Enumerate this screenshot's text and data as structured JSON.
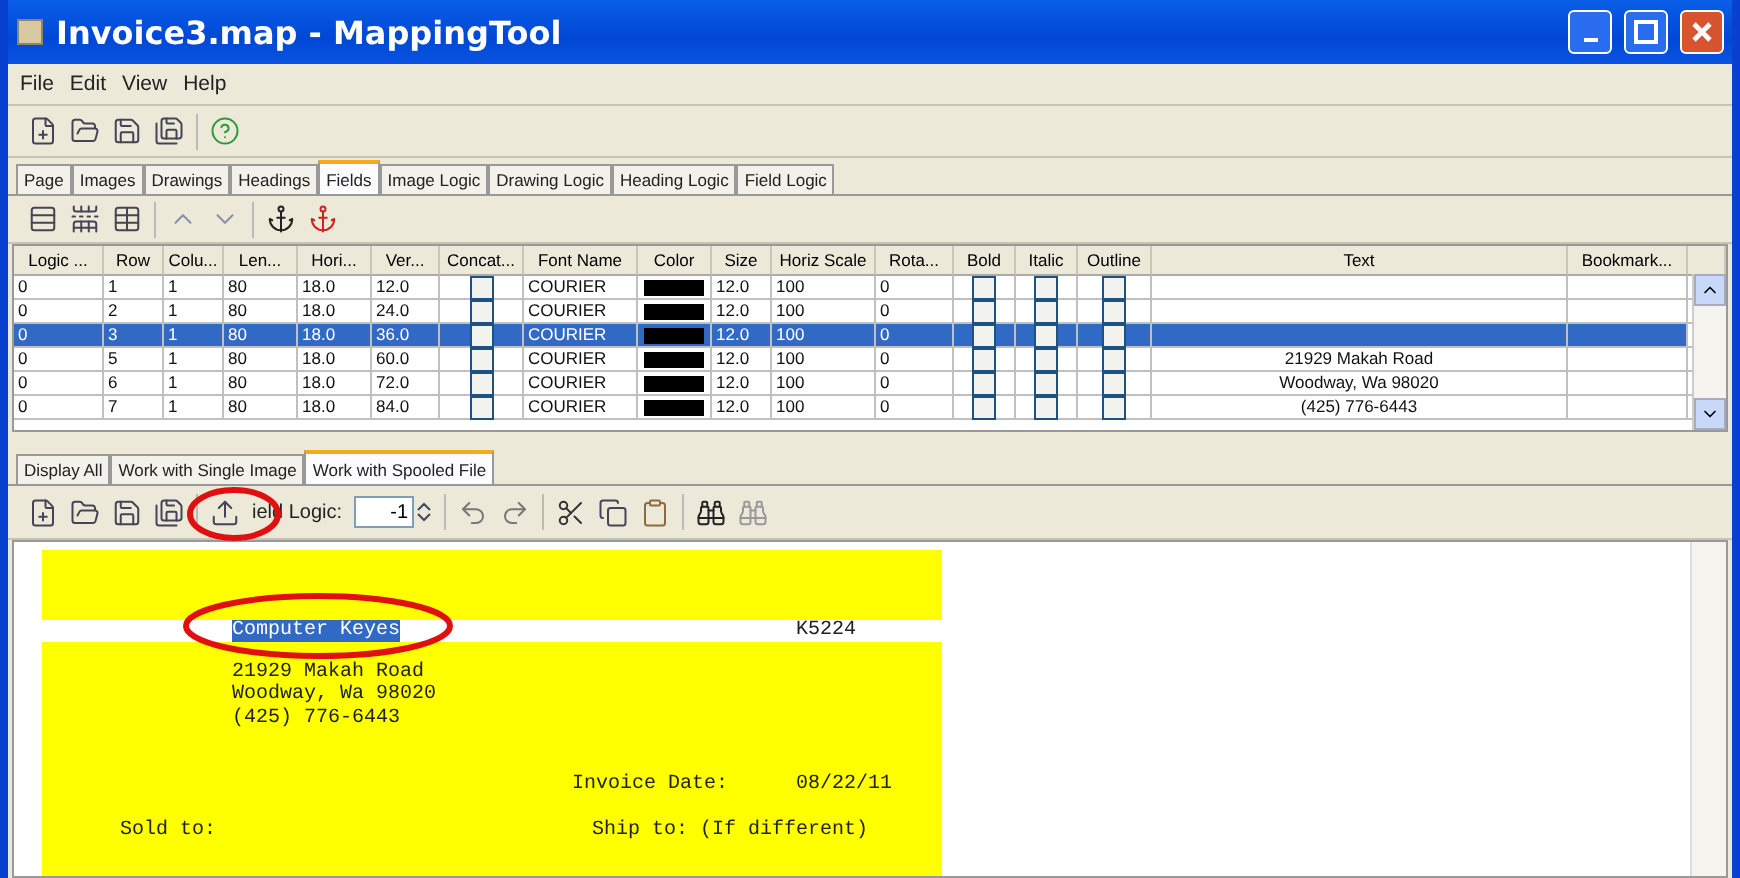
{
  "window": {
    "title": "Invoice3.map - MappingTool"
  },
  "menu": [
    "File",
    "Edit",
    "View",
    "Help"
  ],
  "tabs": [
    {
      "label": "Page",
      "selected": false
    },
    {
      "label": "Images",
      "selected": false
    },
    {
      "label": "Drawings",
      "selected": false
    },
    {
      "label": "Headings",
      "selected": false
    },
    {
      "label": "Fields",
      "selected": true
    },
    {
      "label": "Image Logic",
      "selected": false
    },
    {
      "label": "Drawing Logic",
      "selected": false
    },
    {
      "label": "Heading Logic",
      "selected": false
    },
    {
      "label": "Field Logic",
      "selected": false
    }
  ],
  "table": {
    "columns": [
      "Logic ...",
      "Row",
      "Colu...",
      "Len...",
      "Hori...",
      "Ver...",
      "Concat...",
      "Font Name",
      "Color",
      "Size",
      "Horiz Scale",
      "Rota...",
      "Bold",
      "Italic",
      "Outline",
      "Text",
      "Bookmark..."
    ],
    "rows": [
      {
        "logic": "0",
        "row": "1",
        "column": "1",
        "length": "80",
        "horiz": "18.0",
        "vert": "12.0",
        "concat": false,
        "font": "COURIER",
        "color": "#000000",
        "size": "12.0",
        "scale": "100",
        "rotation": "0",
        "bold": false,
        "italic": false,
        "outline": false,
        "selected": false
      },
      {
        "logic": "0",
        "row": "2",
        "column": "1",
        "length": "80",
        "horiz": "18.0",
        "vert": "24.0",
        "concat": false,
        "font": "COURIER",
        "color": "#000000",
        "size": "12.0",
        "scale": "100",
        "rotation": "0",
        "bold": false,
        "italic": false,
        "outline": false,
        "selected": false
      },
      {
        "logic": "0",
        "row": "3",
        "column": "1",
        "length": "80",
        "horiz": "18.0",
        "vert": "36.0",
        "concat": false,
        "font": "COURIER",
        "color": "#000000",
        "size": "12.0",
        "scale": "100",
        "rotation": "0",
        "bold": false,
        "italic": false,
        "outline": false,
        "selected": true
      },
      {
        "logic": "0",
        "row": "5",
        "column": "1",
        "length": "80",
        "horiz": "18.0",
        "vert": "60.0",
        "concat": false,
        "font": "COURIER",
        "color": "#000000",
        "size": "12.0",
        "scale": "100",
        "rotation": "0",
        "bold": false,
        "italic": false,
        "outline": false,
        "text": "21929 Makah Road",
        "selected": false
      },
      {
        "logic": "0",
        "row": "6",
        "column": "1",
        "length": "80",
        "horiz": "18.0",
        "vert": "72.0",
        "concat": false,
        "font": "COURIER",
        "color": "#000000",
        "size": "12.0",
        "scale": "100",
        "rotation": "0",
        "bold": false,
        "italic": false,
        "outline": false,
        "text": "Woodway, Wa  98020",
        "selected": false
      },
      {
        "logic": "0",
        "row": "7",
        "column": "1",
        "length": "80",
        "horiz": "18.0",
        "vert": "84.0",
        "concat": false,
        "font": "COURIER",
        "color": "#000000",
        "size": "12.0",
        "scale": "100",
        "rotation": "0",
        "bold": false,
        "italic": false,
        "outline": false,
        "text": "(425) 776-6443",
        "selected": false
      }
    ]
  },
  "lower_tabs": [
    {
      "label": "Display All",
      "selected": false
    },
    {
      "label": "Work with Single Image",
      "selected": false
    },
    {
      "label": "Work with Spooled File",
      "selected": true
    }
  ],
  "field_logic": {
    "label": "ield Logic:",
    "value": "-1"
  },
  "document": {
    "company": {
      "text": "Computer Keyes",
      "selected": true
    },
    "doc_number": "K5224",
    "address_lines": [
      "21929 Makah Road",
      "Woodway, Wa  98020",
      "(425) 776-6443"
    ],
    "invoice_date_label": "Invoice Date:",
    "invoice_date": "08/22/11",
    "sold_to": "Sold to:",
    "ship_to": "Ship to: (If different)"
  }
}
